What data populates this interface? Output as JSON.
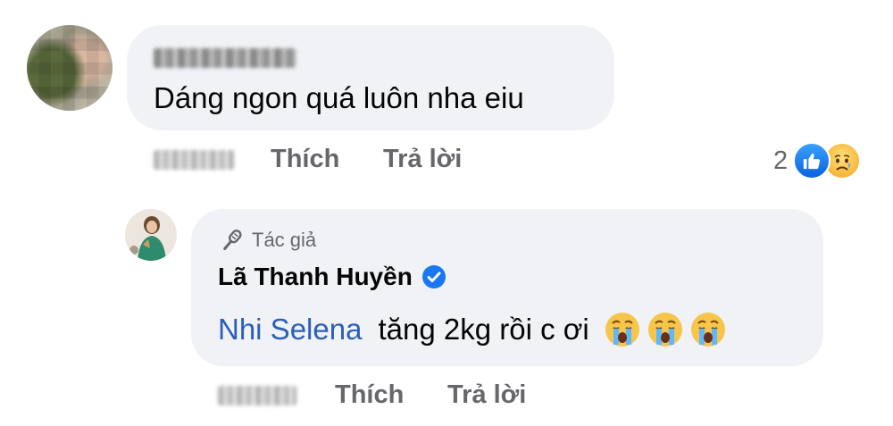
{
  "comment": {
    "text": "Dáng ngon quá luôn nha eiu",
    "actions": {
      "like": "Thích",
      "reply": "Trả lời"
    },
    "reactions": {
      "count": "2",
      "icons": [
        "like-icon",
        "sad-icon"
      ]
    }
  },
  "reply": {
    "author_badge": "Tác giả",
    "author_name": "Lã Thanh Huyền",
    "mention": "Nhi Selena",
    "text": "tăng 2kg rồi c ơi",
    "emojis": [
      "loudly-crying-face-icon",
      "loudly-crying-face-icon",
      "loudly-crying-face-icon"
    ],
    "actions": {
      "like": "Thích",
      "reply": "Trả lời"
    }
  },
  "colors": {
    "bubble": "#f0f2f5",
    "secondary_text": "#65676b",
    "mention": "#2b5fb8",
    "verified": "#1877f2"
  }
}
